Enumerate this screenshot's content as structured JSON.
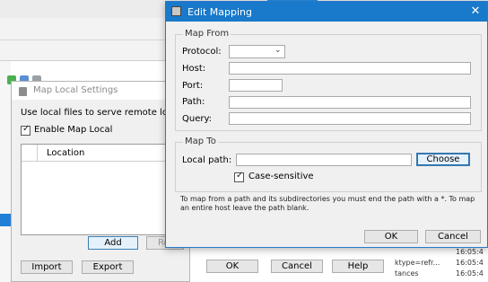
{
  "map_local": {
    "title": "Map Local Settings",
    "description": "Use local files to serve remote loc",
    "enable_label": "Enable Map Local",
    "enabled": true,
    "table_header": "Location",
    "add_label": "Add",
    "remove_label": "Re",
    "import_label": "Import",
    "export_label": "Export"
  },
  "background_dialog": {
    "ok_label": "OK",
    "cancel_label": "Cancel",
    "help_label": "Help"
  },
  "log": {
    "rows": [
      {
        "left": "",
        "right": "16:05:4"
      },
      {
        "left": "ktype=refr...",
        "right": "16:05:4"
      },
      {
        "left": "tances",
        "right": "16:05:4"
      }
    ]
  },
  "edit_mapping": {
    "title": "Edit Mapping",
    "map_from": {
      "legend": "Map From",
      "protocol_label": "Protocol:",
      "protocol_value": "",
      "host_label": "Host:",
      "host_value": "",
      "port_label": "Port:",
      "port_value": "",
      "path_label": "Path:",
      "path_value": "",
      "query_label": "Query:",
      "query_value": ""
    },
    "map_to": {
      "legend": "Map To",
      "local_path_label": "Local path:",
      "local_path_value": "",
      "choose_label": "Choose",
      "case_sensitive_label": "Case-sensitive",
      "case_sensitive": true
    },
    "note": "To map from a path and its subdirectories you must end the path with a *. To map an entire host leave the path blank.",
    "ok_label": "OK",
    "cancel_label": "Cancel"
  },
  "colors": {
    "title_bar": "#1979ca",
    "selection": "#1f7fd6",
    "focus_border": "#3c7fb1"
  }
}
